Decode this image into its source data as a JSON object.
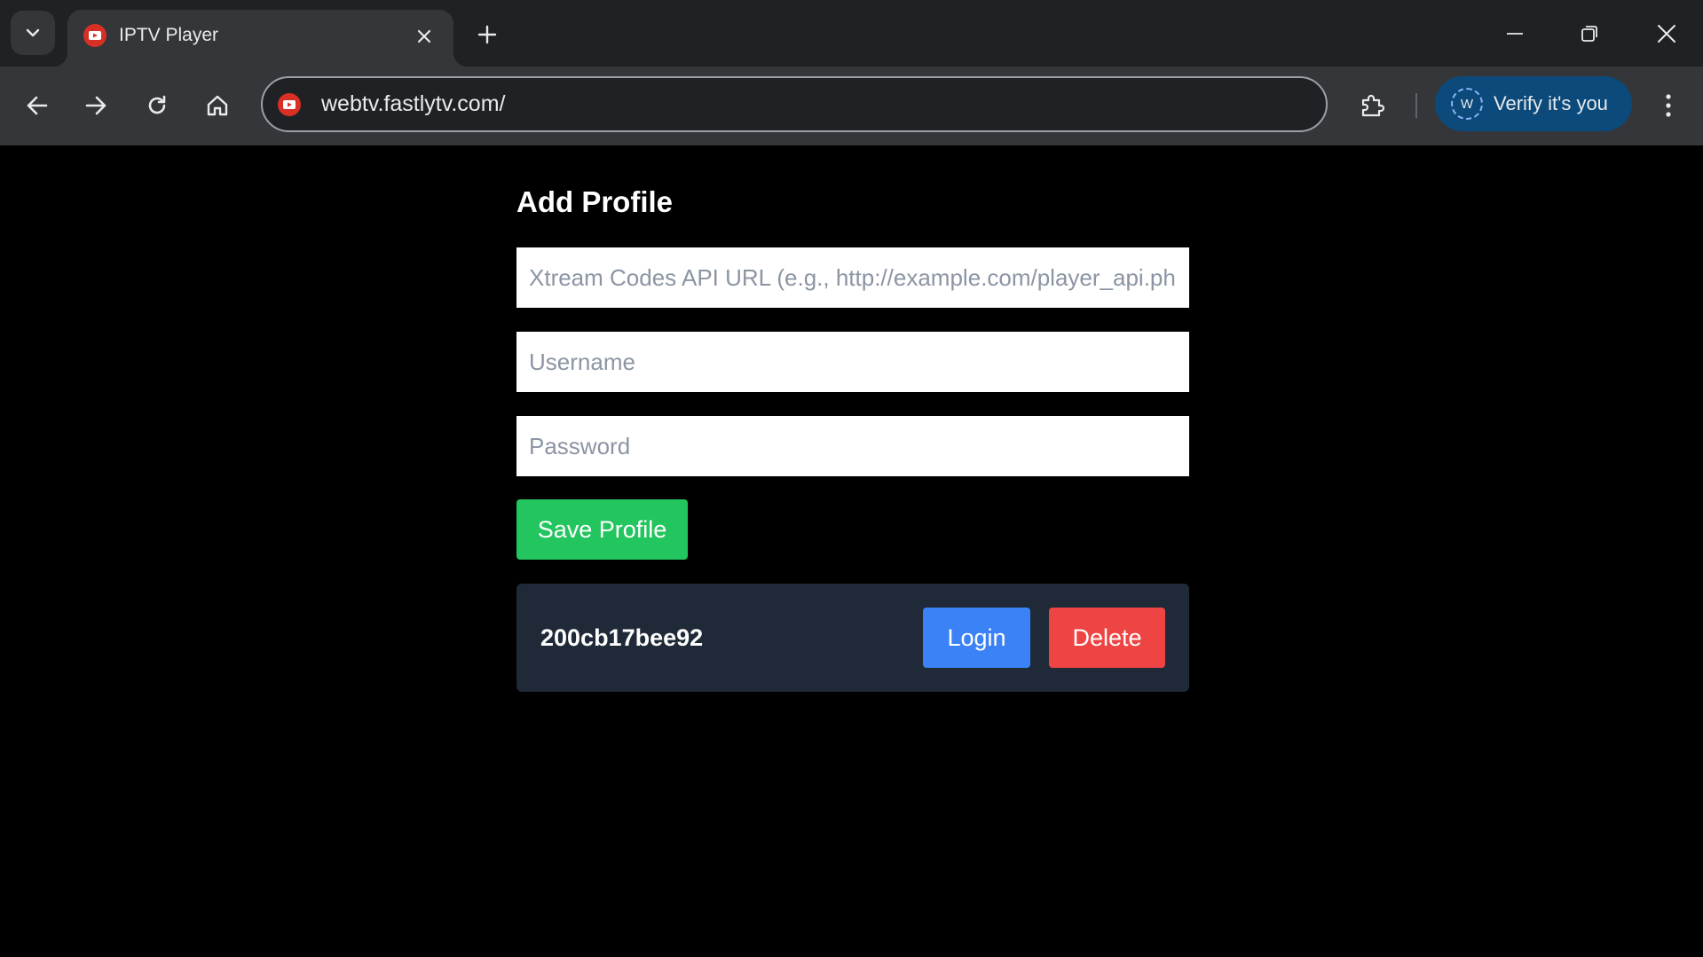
{
  "browser": {
    "tab": {
      "title": "IPTV Player"
    },
    "address_bar": {
      "url": "webtv.fastlytv.com/"
    },
    "profile_chip": {
      "avatar_letter": "W",
      "label": "Verify it's you"
    },
    "colors": {
      "tabbar": "#202124",
      "toolbar": "#35363a",
      "chip": "#0b4a7a",
      "favicon": "#d93025"
    }
  },
  "page": {
    "title": "Add Profile",
    "form": {
      "api_url_placeholder": "Xtream Codes API URL (e.g., http://example.com/player_api.php)",
      "api_url_value": "",
      "username_placeholder": "Username",
      "username_value": "",
      "password_placeholder": "Password",
      "password_value": "",
      "save_label": "Save Profile"
    },
    "profiles": [
      {
        "name": "200cb17bee92",
        "login_label": "Login",
        "delete_label": "Delete"
      }
    ],
    "colors": {
      "save": "#22c55e",
      "login": "#3b82f6",
      "delete": "#ef4444",
      "card": "#1f2937"
    }
  }
}
